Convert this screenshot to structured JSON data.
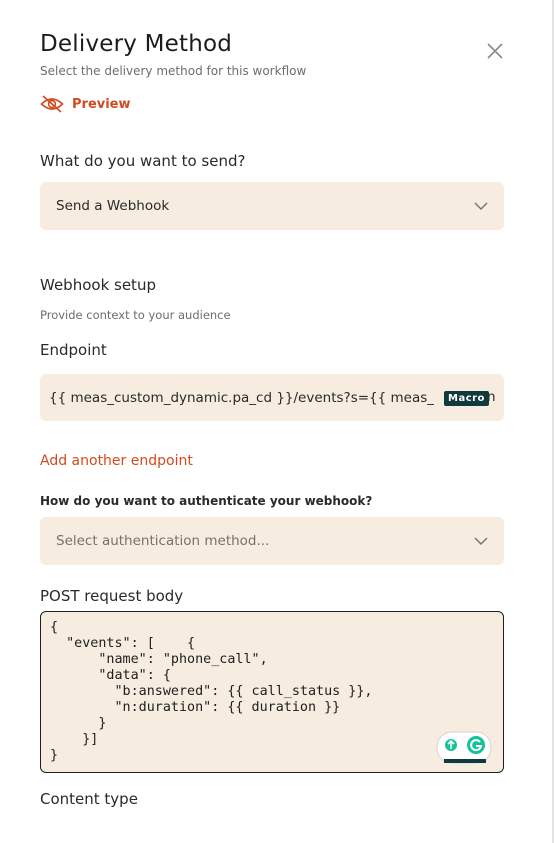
{
  "header": {
    "title": "Delivery Method",
    "subtitle": "Select the delivery method for this workflow",
    "close_icon": "close-icon"
  },
  "preview": {
    "label": "Preview",
    "icon": "eye-off-icon"
  },
  "send": {
    "question": "What do you want to send?",
    "selected": "Send a Webhook"
  },
  "webhook_setup": {
    "title": "Webhook setup",
    "help": "Provide context to your audience"
  },
  "endpoint": {
    "label": "Endpoint",
    "value": "{{ meas_custom_dynamic.pa_cd }}/events?s={{ meas_",
    "macro_tag": "Macro",
    "tail": "n"
  },
  "add_endpoint": "Add another endpoint",
  "auth": {
    "question": "How do you want to authenticate your webhook?",
    "placeholder": "Select authentication method..."
  },
  "post_body": {
    "label": "POST request body",
    "value": "{\n  \"events\": [    {\n      \"name\": \"phone_call\",\n      \"data\": {\n        \"b:answered\": {{ call_status }},\n        \"n:duration\": {{ duration }}\n      }\n    }]\n}"
  },
  "content_type": {
    "label": "Content type"
  },
  "colors": {
    "accent": "#d24a1e",
    "field_bg": "#f6ece0",
    "macro_bg": "#113a3e"
  }
}
